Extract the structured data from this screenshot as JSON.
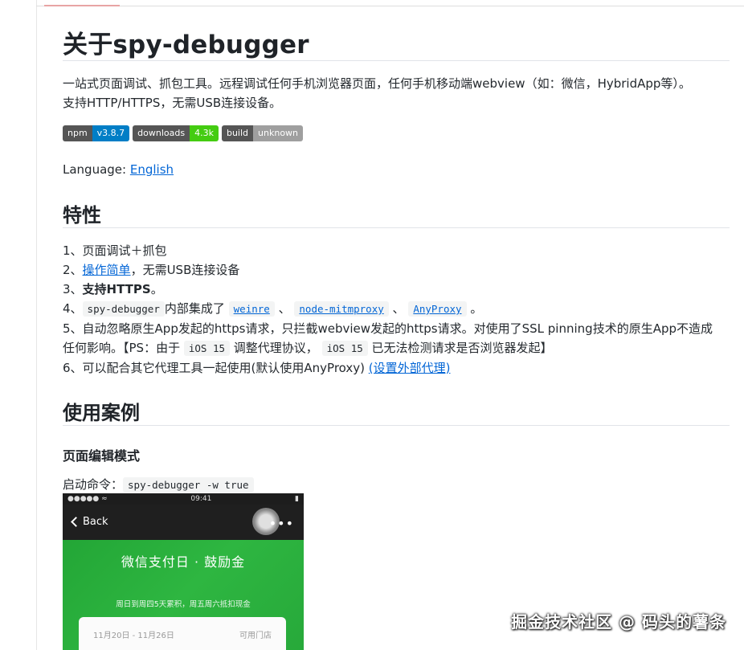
{
  "page": {
    "title": "关于spy-debugger",
    "intro_line1": "一站式页面调试、抓包工具。远程调试任何手机浏览器页面，任何手机移动端webview（如：微信，HybridApp等）。",
    "intro_line2": "支持HTTP/HTTPS，无需USB连接设备。",
    "badges": [
      {
        "label": "npm",
        "value": "v3.8.7",
        "color": "#007ec6"
      },
      {
        "label": "downloads",
        "value": "4.3k",
        "color": "#4c1"
      },
      {
        "label": "build",
        "value": "unknown",
        "color": "#9f9f9f"
      }
    ],
    "language_label": "Language: ",
    "language_link": "English",
    "features_title": "特性",
    "features": {
      "f1": "1、页面调试＋抓包",
      "f2_prefix": "2、",
      "f2_link": "操作简单",
      "f2_suffix": "，无需USB连接设备",
      "f3_prefix": "3、",
      "f3_bold": "支持HTTPS",
      "f3_suffix": "。",
      "f4_prefix": "4、",
      "f4_code": "spy-debugger",
      "f4_mid": "内部集成了",
      "f4_link1": "weinre",
      "f4_sep1": "、",
      "f4_link2": "node-mitmproxy",
      "f4_sep2": "、",
      "f4_link3": "AnyProxy",
      "f4_end": "。",
      "f5_line1": "5、自动忽略原生App发起的https请求，只拦截webview发起的https请求。对使用了SSL pinning技术的原生App不造成",
      "f5_line2_a": "任何影响。【PS：由于",
      "f5_code1": "iOS 15",
      "f5_line2_b": "调整代理协议，",
      "f5_code2": "iOS 15",
      "f5_line2_c": "已无法检测请求是否浏览器发起】",
      "f6_text": "6、可以配合其它代理工具一起使用(默认使用AnyProxy) ",
      "f6_link": "(设置外部代理)"
    },
    "cases_title": "使用案例",
    "mode_title": "页面编辑模式",
    "cmd_label": "启动命令：",
    "cmd_code": "spy-debugger -w true"
  },
  "phone": {
    "signal": "●●●●● ≈",
    "time": "09:41",
    "battery": "▮",
    "back_label": "Back",
    "menu_dots": "•••",
    "hero_title": "微信支付日 · 鼓励金",
    "note": "周日到周四5天累积，周五周六抵扣现金",
    "card_date": "11月20日 - 11月26日",
    "card_store": "可用门店"
  },
  "watermark": "掘金技术社区 @ 码头的薯条"
}
